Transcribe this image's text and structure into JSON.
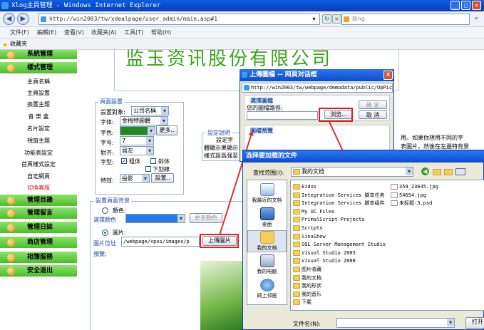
{
  "browser": {
    "title": "Xlog主頁管理 - Windows Internet Explorer",
    "url": "http://win2003/tw/xdealpage/user_admin/main.asp#1",
    "search_placeholder": "Bing",
    "menu": [
      "文件(F)",
      "編輯(E)",
      "查看(V)",
      "收藏夹(A)",
      "工具(T)",
      "帮助(H)"
    ],
    "favorites_label": "收藏夹"
  },
  "sidebar": {
    "main_items": [
      "系統管理",
      "樣式管理",
      "管理目錄",
      "管理留言",
      "管理日誌",
      "商店管理",
      "相簿服務",
      "安全退出"
    ],
    "sub_items": [
      "主頁名稱",
      "主頁設置",
      "換置主題",
      "音 樂 盒",
      "名片設定",
      "視窗主題",
      "功能表設定",
      "首頁樣式設定",
      "自定網頁",
      "切換客服"
    ]
  },
  "page": {
    "company_name": "监玉资讯股份有限公司",
    "page_settings": {
      "legend": "頁面設置",
      "target_label": "設置對象:",
      "target_value": "公司名稱",
      "font_label": "字体:",
      "font_value": "金梅特圓體",
      "color_label": "字色:",
      "more_label": "更多..",
      "size_label": "字号:",
      "size_value": "7",
      "align_label": "對齐:",
      "align_value": "居左",
      "style_label": "字型:",
      "bold_label": "粗体",
      "italic_label": "斜体",
      "underline_label": "下划線",
      "effect_label": "特效:",
      "effect_value": "投影",
      "setup_label": "設置.."
    },
    "settings_desc": {
      "legend": "設定說明",
      "line1": "設定字",
      "line2": "體顯示果顯示",
      "line3": "樣式設爲强至"
    },
    "right_note": {
      "line1": "用。如果你想用不同的字",
      "line2": "表圖片，然後在左邊特背景"
    },
    "background": {
      "legend": "設置頁面背景",
      "color_radio_label": "顏色:",
      "choose_color_label": "選擇顏色",
      "more_colors_label": "更多顏色",
      "image_radio_label": "圖片:",
      "image_url_label": "圖片位址",
      "image_url_value": "/webpage/xpos/images/p",
      "upload_label": "上傳圖片",
      "preview_label": "預覽:"
    }
  },
  "upload_dialog": {
    "title": "上傳圖檔 -- 网頁对话框",
    "url": "http://win2003/tw/webpage/demodata/public/UpPic.asp",
    "choose_label": "選擇圖檔",
    "path_label": "您的圖檔路徑:",
    "browse_label": "浏览...",
    "ok_label": "確 定",
    "cancel_label": "取 消",
    "preview_label": "圖檔預覽"
  },
  "file_dialog": {
    "title": "选择要加载的文件",
    "look_in_label": "查找范围(I):",
    "look_in_value": "我的文档",
    "places": [
      "我最近的文档",
      "桌面",
      "我的文档",
      "我的电脑",
      "网上邻居"
    ],
    "folders_col1": [
      "Eidos",
      "Integration Services 脚本任务",
      "Integration Services 脚本组件",
      "My UC Files",
      "PrimalScript Projects",
      "Scripts",
      "SinaShow",
      "SQL Server Management Studio",
      "Visual Studio 2005",
      "Visual Studio 2008",
      "图片收藏",
      "我的文档",
      "我的形状",
      "我的音乐",
      "下载"
    ],
    "files_col2": [
      "359_23645.jpg",
      "54654.jpg",
      "未标题-3.psd"
    ],
    "filename_label": "文件名(N):",
    "open_label": "打开"
  }
}
